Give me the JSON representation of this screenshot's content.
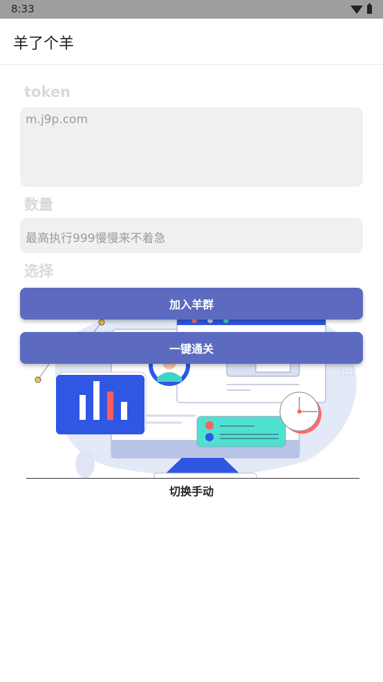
{
  "status_bar": {
    "time": "8:33",
    "wifi_icon": "wifi-icon",
    "battery_icon": "battery-icon"
  },
  "app_bar": {
    "title": "羊了个羊"
  },
  "form": {
    "token_label": "token",
    "token_placeholder": "m.j9p.com",
    "count_label": "数量",
    "count_placeholder": "最高执行999慢慢来不着急",
    "choose_label": "选择"
  },
  "buttons": {
    "join_group": "加入羊群",
    "one_click_clear": "一键通关"
  },
  "switch_manual": "切换手动",
  "colors": {
    "accent": "#5c6bc0",
    "field_bg": "#f0f0f0",
    "status_bar": "#9e9e9e"
  }
}
